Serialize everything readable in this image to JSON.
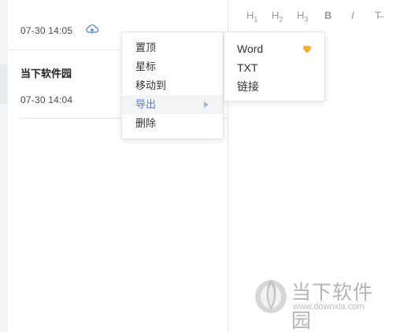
{
  "note_list": {
    "items": [
      {
        "title": "",
        "timestamp": "07-30 14:05",
        "icon": "cloud-upload-icon"
      },
      {
        "title": "当下软件园",
        "timestamp": "07-30 14:04"
      }
    ]
  },
  "editor": {
    "toolbar": [
      {
        "name": "heading-1",
        "glyph": "H",
        "sub": "1"
      },
      {
        "name": "heading-2",
        "glyph": "H",
        "sub": "2"
      },
      {
        "name": "heading-3",
        "glyph": "H",
        "sub": "3"
      },
      {
        "name": "bold",
        "glyph": "B",
        "sub": ""
      },
      {
        "name": "italic",
        "glyph": "I",
        "sub": ""
      },
      {
        "name": "strikethrough",
        "glyph": "T̶",
        "sub": ""
      }
    ]
  },
  "context_menu": {
    "items": [
      {
        "label": "置顶"
      },
      {
        "label": "星标"
      },
      {
        "label": "移动到"
      },
      {
        "label": "导出",
        "active": true,
        "has_submenu": true
      },
      {
        "label": "删除"
      }
    ]
  },
  "export_submenu": {
    "items": [
      {
        "label": "Word",
        "badge_icon": "vip-diamond-icon",
        "badge_color": "#f5a623"
      },
      {
        "label": "TXT"
      },
      {
        "label": "链接"
      }
    ]
  },
  "watermark": {
    "name": "当下软件园",
    "url": "www.downxia.com"
  },
  "colors": {
    "accent": "#4a7fd6",
    "muted": "#9a9a9a",
    "badge": "#f5a623"
  }
}
